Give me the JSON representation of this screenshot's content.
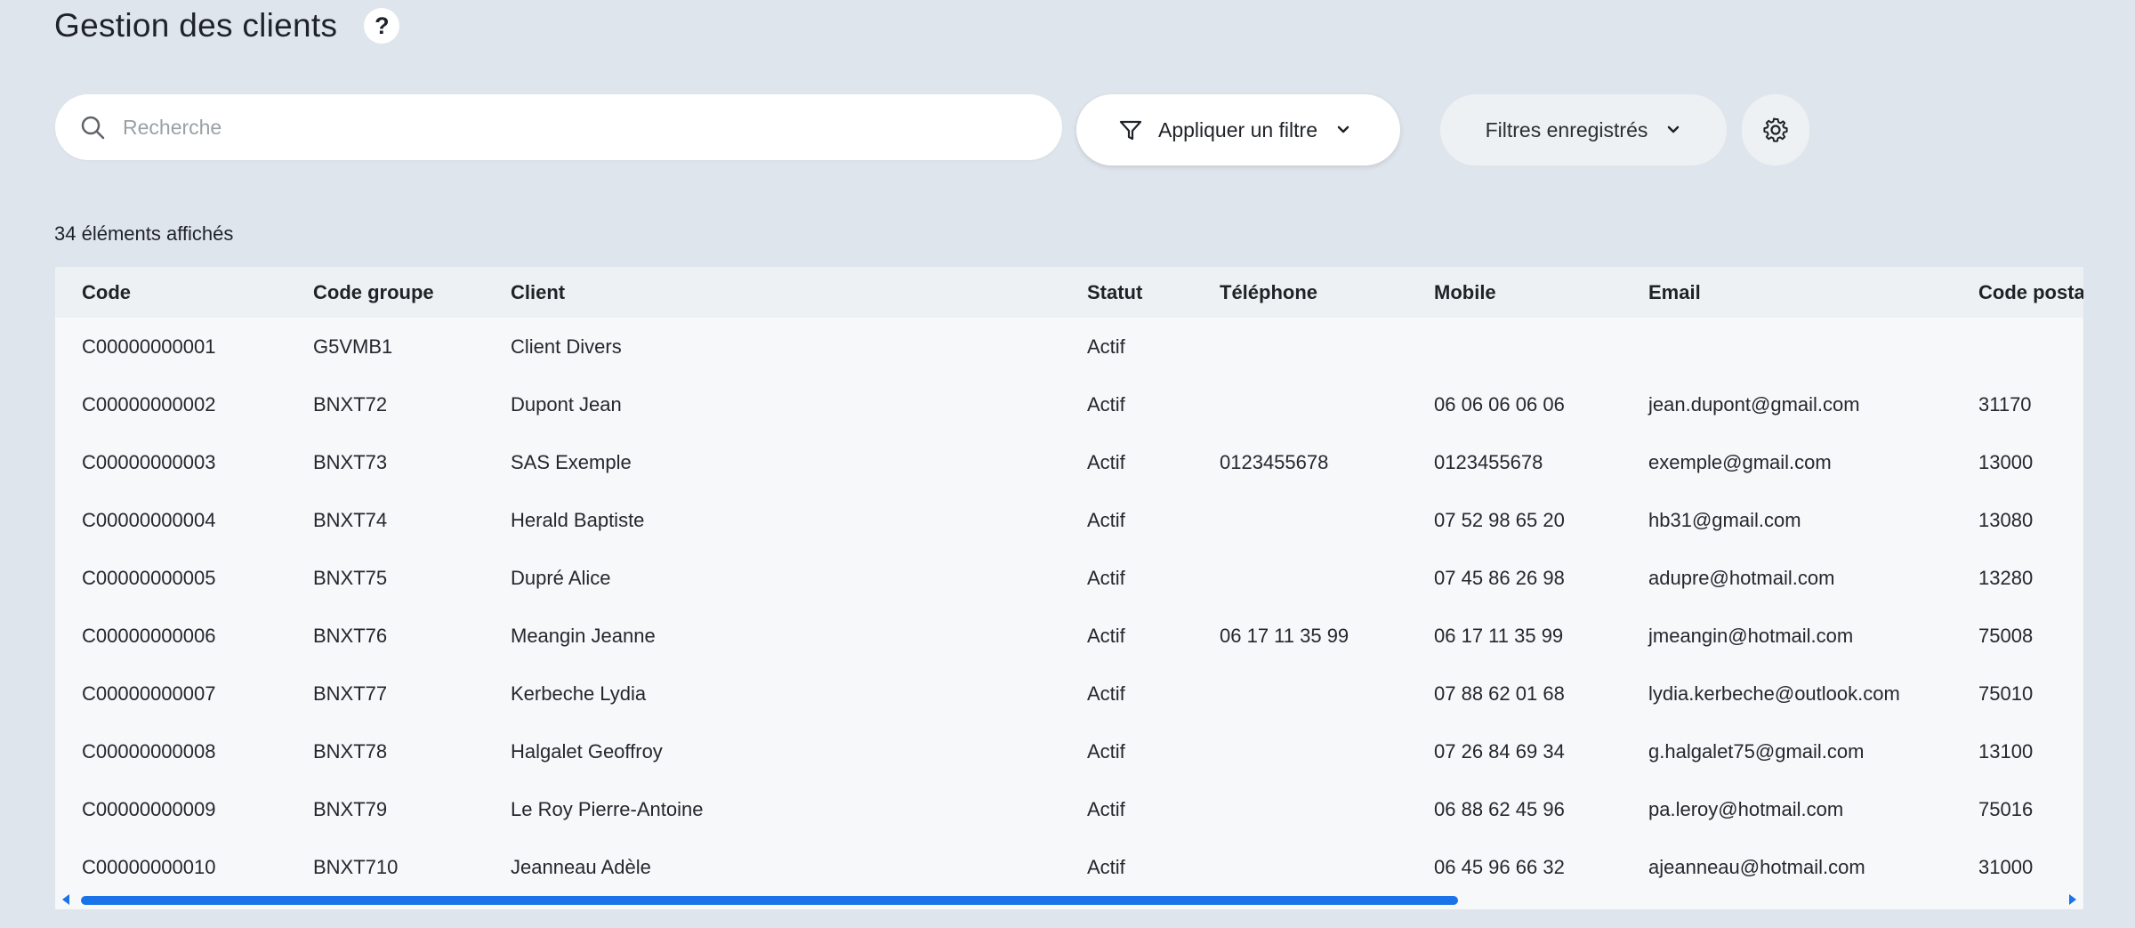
{
  "page": {
    "title": "Gestion des clients",
    "help_label": "?"
  },
  "search": {
    "placeholder": "Recherche",
    "value": ""
  },
  "toolbar": {
    "filter_label": "Appliquer un filtre",
    "saved_filters_label": "Filtres enregistrés",
    "icons": {
      "search": "search-icon",
      "filter": "funnel-icon",
      "chevron": "chevron-down-icon",
      "settings": "gear-icon"
    }
  },
  "results": {
    "count_text": "34 éléments affichés"
  },
  "table": {
    "columns": [
      "Code",
      "Code groupe",
      "Client",
      "Statut",
      "Téléphone",
      "Mobile",
      "Email",
      "Code postal"
    ],
    "rows": [
      [
        "C00000000001",
        "G5VMB1",
        "Client Divers",
        "Actif",
        "",
        "",
        "",
        ""
      ],
      [
        "C00000000002",
        "BNXT72",
        "Dupont Jean",
        "Actif",
        "",
        "06 06 06 06 06",
        "jean.dupont@gmail.com",
        "31170"
      ],
      [
        "C00000000003",
        "BNXT73",
        "SAS Exemple",
        "Actif",
        "0123455678",
        "0123455678",
        "exemple@gmail.com",
        "13000"
      ],
      [
        "C00000000004",
        "BNXT74",
        "Herald Baptiste",
        "Actif",
        "",
        "07 52 98 65 20",
        "hb31@gmail.com",
        "13080"
      ],
      [
        "C00000000005",
        "BNXT75",
        "Dupré Alice",
        "Actif",
        "",
        "07 45 86 26 98",
        "adupre@hotmail.com",
        "13280"
      ],
      [
        "C00000000006",
        "BNXT76",
        "Meangin Jeanne",
        "Actif",
        "06 17 11 35 99",
        "06 17 11 35 99",
        "jmeangin@hotmail.com",
        "75008"
      ],
      [
        "C00000000007",
        "BNXT77",
        "Kerbeche Lydia",
        "Actif",
        "",
        "07 88 62 01 68",
        "lydia.kerbeche@outlook.com",
        "75010"
      ],
      [
        "C00000000008",
        "BNXT78",
        "Halgalet Geoffroy",
        "Actif",
        "",
        "07 26 84 69 34",
        "g.halgalet75@gmail.com",
        "13100"
      ],
      [
        "C00000000009",
        "BNXT79",
        "Le Roy Pierre-Antoine",
        "Actif",
        "",
        "06 88 62 45 96",
        "pa.leroy@hotmail.com",
        "75016"
      ],
      [
        "C00000000010",
        "BNXT710",
        "Jeanneau Adèle",
        "Actif",
        "",
        "06 45 96 66 32",
        "ajeanneau@hotmail.com",
        "31000"
      ]
    ]
  },
  "scrollbar": {
    "horizontal_position_fraction": 0.0,
    "visible_fraction": 0.68
  },
  "colors": {
    "background": "#dfe5ec",
    "accent": "#1a73e8",
    "table_header": "#eef1f3",
    "table_body": "#f6f8fa"
  }
}
